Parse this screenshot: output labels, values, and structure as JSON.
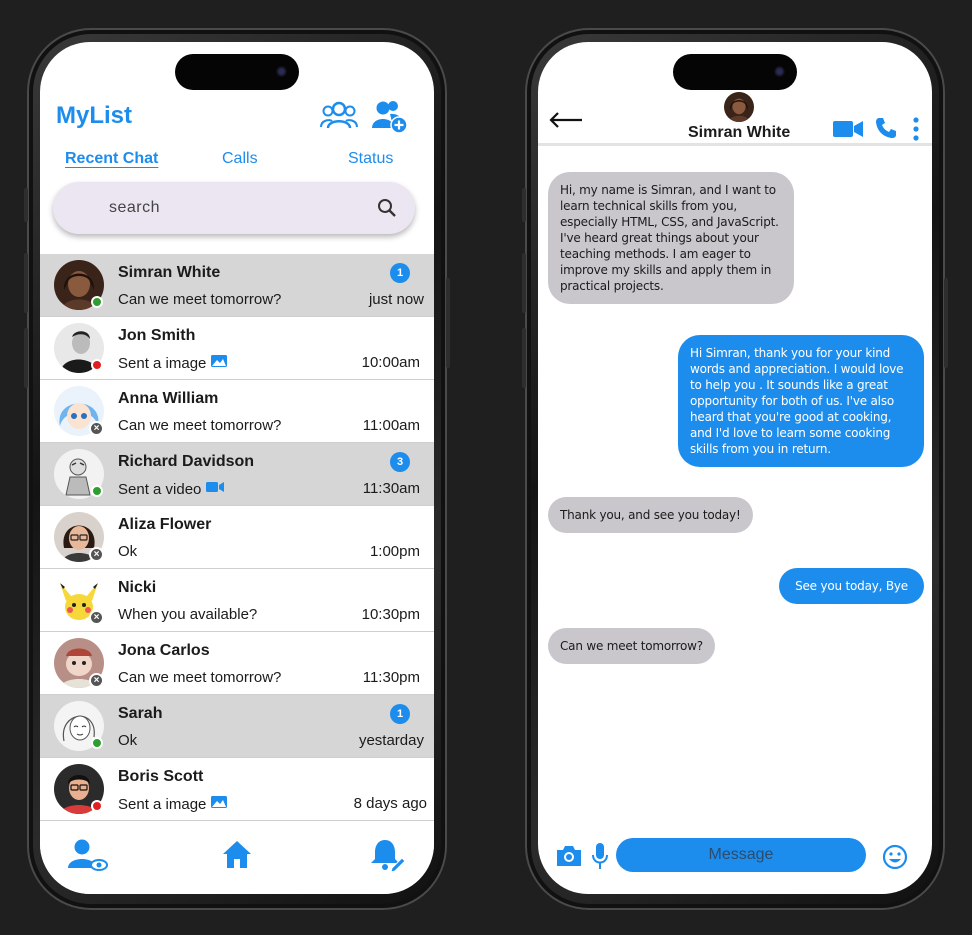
{
  "left": {
    "app_title": "MyList",
    "tabs": [
      {
        "label": "Recent Chat",
        "active": true
      },
      {
        "label": "Calls",
        "active": false
      },
      {
        "label": "Status",
        "active": false
      }
    ],
    "search": {
      "placeholder": "search"
    },
    "chats": [
      {
        "name": "Simran White",
        "message": "Can we meet tomorrow?",
        "time": "just now",
        "badge": "1",
        "status": "online",
        "unread": true,
        "attachment": ""
      },
      {
        "name": "Jon Smith",
        "message": "Sent a image",
        "time": "10:00am",
        "badge": "",
        "status": "busy",
        "unread": false,
        "attachment": "image-icon"
      },
      {
        "name": "Anna William",
        "message": "Can we meet tomorrow?",
        "time": "11:00am",
        "badge": "",
        "status": "offline",
        "unread": false,
        "attachment": ""
      },
      {
        "name": "Richard Davidson",
        "message": "Sent a video",
        "time": "11:30am",
        "badge": "3",
        "status": "online",
        "unread": true,
        "attachment": "video-icon"
      },
      {
        "name": "Aliza Flower",
        "message": "Ok",
        "time": "1:00pm",
        "badge": "",
        "status": "offline",
        "unread": false,
        "attachment": ""
      },
      {
        "name": "Nicki",
        "message": "When you available?",
        "time": "10:30pm",
        "badge": "",
        "status": "offline",
        "unread": false,
        "attachment": ""
      },
      {
        "name": "Jona Carlos",
        "message": "Can we meet tomorrow?",
        "time": "11:30pm",
        "badge": "",
        "status": "offline",
        "unread": false,
        "attachment": ""
      },
      {
        "name": "Sarah",
        "message": "Ok",
        "time": "yestarday",
        "badge": "1",
        "status": "online",
        "unread": true,
        "attachment": ""
      },
      {
        "name": "Boris Scott",
        "message": "Sent a image",
        "time": "8 days ago",
        "badge": "",
        "status": "busy",
        "unread": false,
        "attachment": "image-icon"
      }
    ]
  },
  "right": {
    "contact_name": "Simran White",
    "messages": [
      {
        "from": "them",
        "text": "Hi, my name is Simran, and I want to learn technical skills from you, especially HTML, CSS, and JavaScript. I've heard great things about your teaching methods. I am eager to improve my skills and apply them in practical projects."
      },
      {
        "from": "me",
        "text": "Hi Simran, thank you for your kind words and appreciation. I would love to help you . It sounds like a great opportunity for both of us. I've also heard that you're good at cooking, and I'd love to learn some cooking skills from you in return."
      },
      {
        "from": "them",
        "text": "Thank you, and see you today!"
      },
      {
        "from": "me",
        "text": "See you today, Bye"
      },
      {
        "from": "them",
        "text": "Can we meet tomorrow?"
      }
    ],
    "composer": {
      "placeholder": "Message"
    }
  },
  "colors": {
    "accent": "#1d8ded",
    "unread_row": "#d6d6d6",
    "incoming_bubble": "#c9c7cc",
    "online": "#2e9e2e",
    "busy": "#e02020",
    "offline": "#555555"
  }
}
